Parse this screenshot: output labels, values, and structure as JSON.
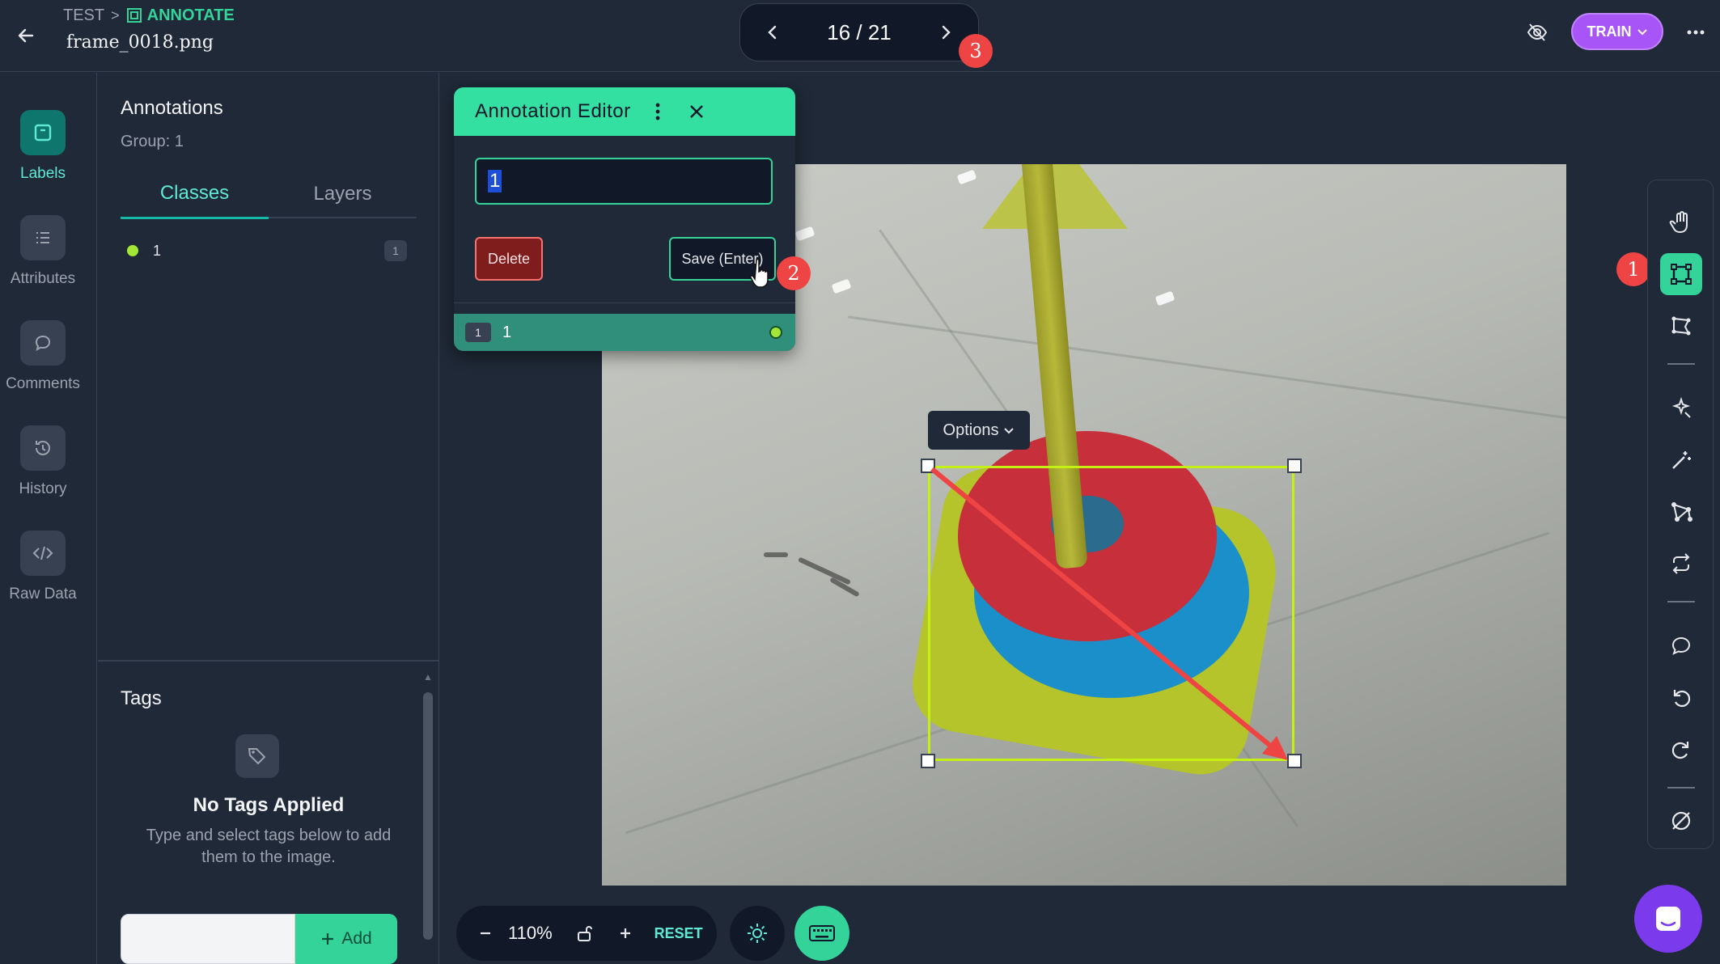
{
  "header": {
    "project": "TEST",
    "separator": ">",
    "section": "ANNOTATE",
    "filename": "frame_0018.png",
    "pager": "16 / 21",
    "train_label": "TRAIN"
  },
  "badges": {
    "toolbar": "1",
    "save": "2",
    "pager": "3"
  },
  "rail": {
    "items": [
      {
        "label": "Labels",
        "icon": "labels-icon",
        "active": true
      },
      {
        "label": "Attributes",
        "icon": "list-icon",
        "active": false
      },
      {
        "label": "Comments",
        "icon": "comment-icon",
        "active": false
      },
      {
        "label": "History",
        "icon": "history-icon",
        "active": false
      },
      {
        "label": "Raw Data",
        "icon": "code-icon",
        "active": false
      }
    ]
  },
  "panel": {
    "title": "Annotations",
    "group": "Group: 1",
    "tabs": [
      "Classes",
      "Layers"
    ],
    "classes": [
      {
        "name": "1",
        "count": "1",
        "color": "#a3e635"
      }
    ]
  },
  "tags": {
    "title": "Tags",
    "empty_title": "No Tags Applied",
    "empty_desc": "Type and select tags below to add them to the image.",
    "input_value": "",
    "add_label": "Add"
  },
  "editor": {
    "title": "Annotation Editor",
    "input_value": "1",
    "delete_label": "Delete",
    "save_label": "Save (Enter)",
    "row_badge": "1",
    "row_label": "1"
  },
  "canvas": {
    "options_label": "Options",
    "box_color": "#c5f015"
  },
  "zoom": {
    "level": "110%",
    "reset_label": "RESET"
  },
  "colors": {
    "accent": "#34d399",
    "train": "#a855f7",
    "badge": "#ef4444"
  }
}
